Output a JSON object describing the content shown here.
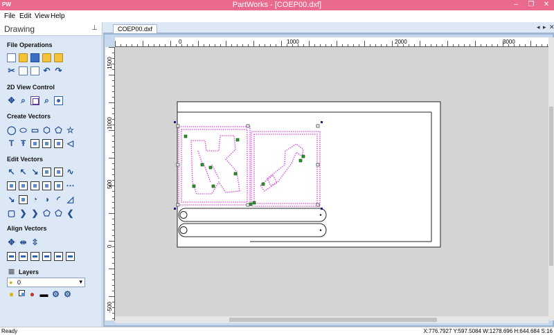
{
  "window": {
    "app_icon": "PW",
    "title": "PartWorks - [COEP00.dxf]",
    "buttons": [
      "–",
      "❐",
      "✕"
    ]
  },
  "menu": [
    "File",
    "Edit",
    "View",
    "Help"
  ],
  "sidebar": {
    "title": "Drawing",
    "pin_icon": "pin-icon",
    "sections": {
      "file_operations": "File Operations",
      "view_control": "2D View Control",
      "create_vectors": "Create Vectors",
      "edit_vectors": "Edit Vectors",
      "align_vectors": "Align Vectors",
      "layers": "Layers"
    },
    "layer_value": "0"
  },
  "tab": {
    "label": "COEP00.dxf",
    "nav": [
      "◂",
      "▸",
      "✕"
    ]
  },
  "rulers": {
    "top_labels": [
      "0",
      "1000",
      "2000",
      "3000"
    ],
    "left_labels": [
      "1500",
      "1000",
      "500",
      "0",
      "-500"
    ]
  },
  "status": {
    "ready": "Ready",
    "coords": "X:776.7927 Y:597.5084    W:1278.696  H:644.684  S:16"
  }
}
